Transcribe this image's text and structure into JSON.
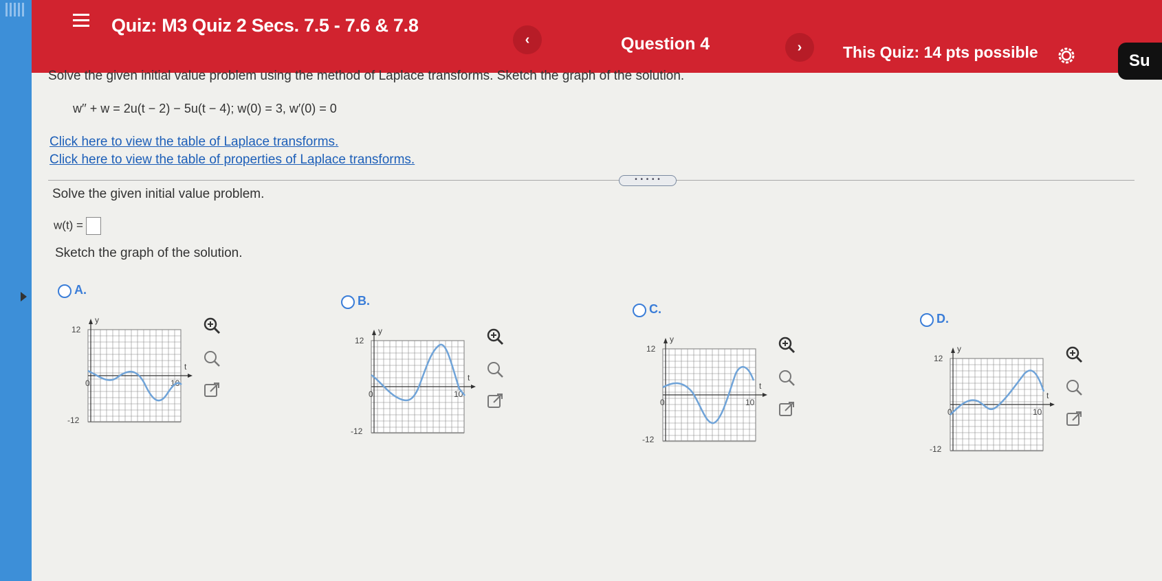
{
  "header": {
    "quiz_title": "Quiz: M3 Quiz 2 Secs. 7.5 - 7.6 & 7.8",
    "prev_label": "‹",
    "question_label": "Question 4",
    "next_label": "›",
    "points_label": "This Quiz: 14 pts possible",
    "submit_label": "Su"
  },
  "problem": {
    "instructions": "Solve the given initial value problem using the method of Laplace transforms. Sketch the graph of the solution.",
    "equation": "w′′ + w = 2u(t − 2) − 5u(t − 4);   w(0) = 3,   w′(0) = 0",
    "link_table": "Click here to view the table of Laplace transforms.",
    "link_properties": "Click here to view the table of properties of Laplace transforms."
  },
  "more_handle": "• • • • •",
  "solve_label": "Solve the given initial value problem.",
  "answer": {
    "label": "w(t) =",
    "value": ""
  },
  "sketch_label": "Sketch the graph of the solution.",
  "options": [
    {
      "letter": "A.",
      "y_top": "12",
      "y_bottom": "-12",
      "x_label": "t",
      "y_label": "y",
      "x_origin": "0",
      "x_end": "10"
    },
    {
      "letter": "B.",
      "y_top": "12",
      "y_bottom": "-12",
      "x_label": "t",
      "y_label": "y",
      "x_origin": "0",
      "x_end": "10"
    },
    {
      "letter": "C.",
      "y_top": "12",
      "y_bottom": "-12",
      "x_label": "t",
      "y_label": "y",
      "x_origin": "0",
      "x_end": "10"
    },
    {
      "letter": "D.",
      "y_top": "12",
      "y_bottom": "-12",
      "x_label": "t",
      "y_label": "y",
      "x_origin": "0",
      "x_end": "10"
    }
  ],
  "colors": {
    "header": "#d1232f",
    "link": "#1d5fb8",
    "curve": "#6fa3d8",
    "radio": "#3a7dd8"
  }
}
